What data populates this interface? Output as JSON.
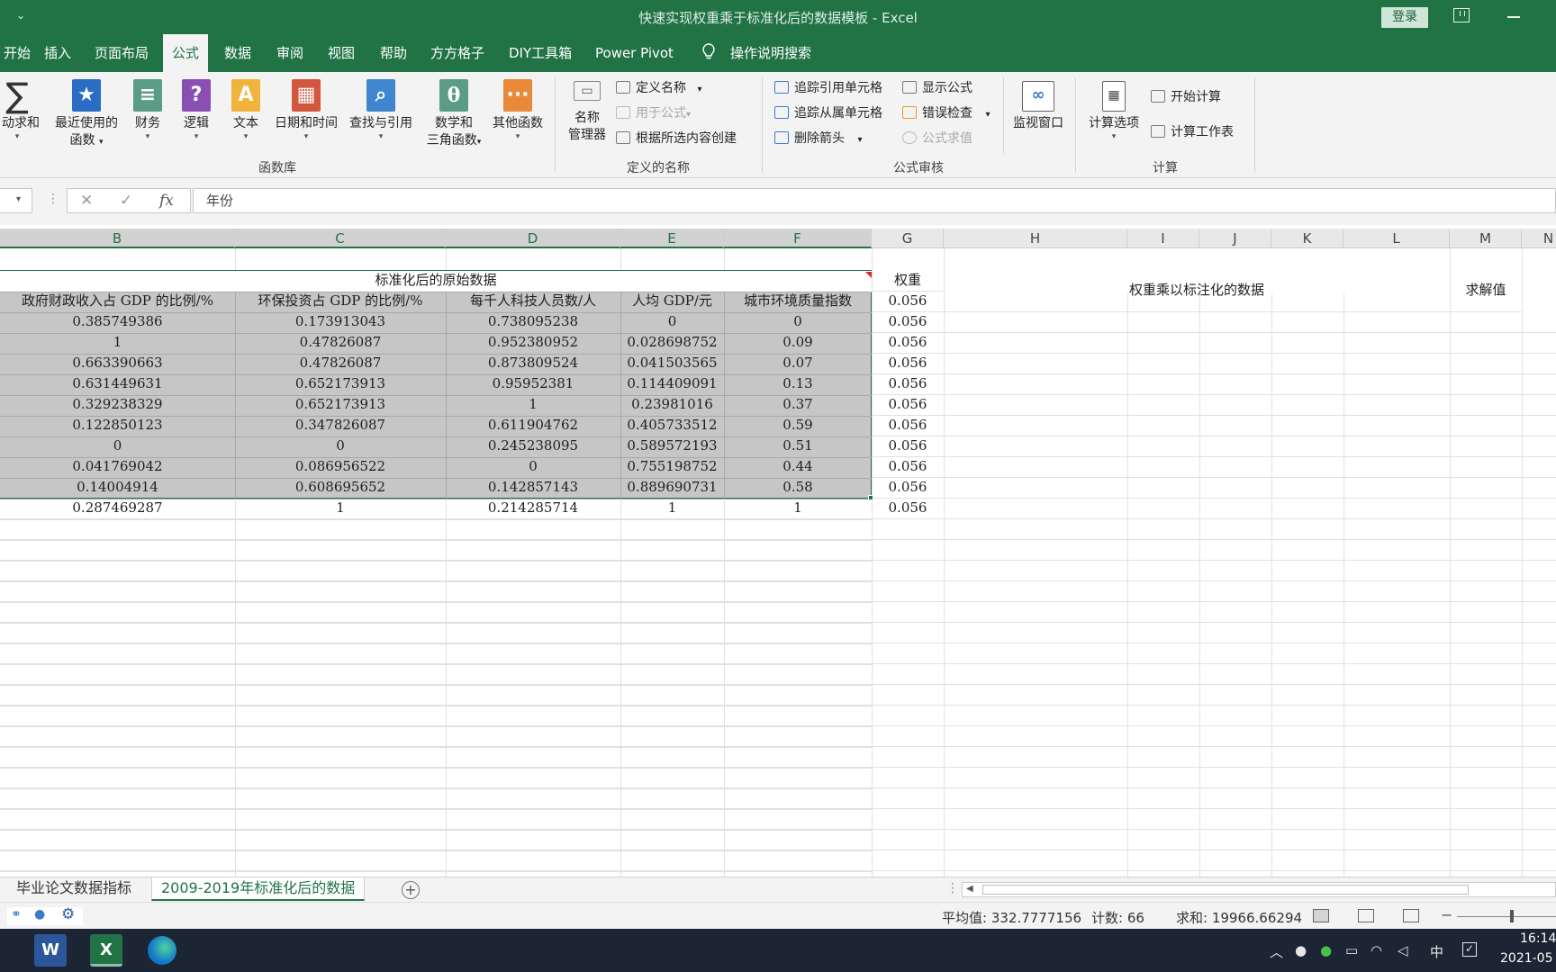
{
  "window": {
    "title": "快速实现权重乘于标准化后的数据模板  -  Excel",
    "login_label": "登录"
  },
  "tabs": [
    "开始",
    "插入",
    "页面布局",
    "公式",
    "数据",
    "审阅",
    "视图",
    "帮助",
    "方方格子",
    "DIY工具箱",
    "Power Pivot"
  ],
  "active_tab": "公式",
  "tell_me": "操作说明搜索",
  "ribbon": {
    "function_library": {
      "label": "函数库",
      "autosum": "自动求和",
      "recent": "最近使用的",
      "recent2": "函数",
      "financial": "财务",
      "logical": "逻辑",
      "text": "文本",
      "datetime": "日期和时间",
      "lookup": "查找与引用",
      "math": "数学和",
      "math2": "三角函数",
      "more": "其他函数"
    },
    "defined_names": {
      "label": "定义的名称",
      "name_manager": "名称",
      "name_manager2": "管理器",
      "define_name": "定义名称",
      "use_in_formula": "用于公式",
      "create_from_selection": "根据所选内容创建"
    },
    "formula_auditing": {
      "label": "公式审核",
      "trace_precedents": "追踪引用单元格",
      "trace_dependents": "追踪从属单元格",
      "remove_arrows": "删除箭头",
      "show_formulas": "显示公式",
      "error_checking": "错误检查",
      "evaluate_formula": "公式求值",
      "watch_window": "监视窗口"
    },
    "calculation": {
      "label": "计算",
      "calc_options": "计算选项",
      "calc_now": "开始计算",
      "calc_sheet": "计算工作表"
    }
  },
  "formula_bar": {
    "cancel": "✕",
    "enter": "✓",
    "fx": "fx",
    "value": "年份"
  },
  "columns": [
    "B",
    "C",
    "D",
    "E",
    "F",
    "G",
    "H",
    "I",
    "J",
    "K",
    "L",
    "M",
    "N"
  ],
  "sheet": {
    "merged_title": "标准化后的原始数据",
    "weight_header": "权重",
    "weighted_header": "权重乘以标注化的数据",
    "solution_header": "求解值",
    "headers": [
      "政府财政收入占 GDP 的比例/%",
      "环保投资占 GDP 的比例/%",
      "每千人科技人员数/人",
      "人均 GDP/元",
      "城市环境质量指数"
    ],
    "weight_first": "0.056",
    "rows": [
      [
        "0.385749386",
        "0.173913043",
        "0.738095238",
        "0",
        "0",
        "0.056"
      ],
      [
        "1",
        "0.47826087",
        "0.952380952",
        "0.028698752",
        "0.09",
        "0.056"
      ],
      [
        "0.663390663",
        "0.47826087",
        "0.873809524",
        "0.041503565",
        "0.07",
        "0.056"
      ],
      [
        "0.631449631",
        "0.652173913",
        "0.95952381",
        "0.114409091",
        "0.13",
        "0.056"
      ],
      [
        "0.329238329",
        "0.652173913",
        "1",
        "0.23981016",
        "0.37",
        "0.056"
      ],
      [
        "0.122850123",
        "0.347826087",
        "0.611904762",
        "0.405733512",
        "0.59",
        "0.056"
      ],
      [
        "0",
        "0",
        "0.245238095",
        "0.589572193",
        "0.51",
        "0.056"
      ],
      [
        "0.041769042",
        "0.086956522",
        "0",
        "0.755198752",
        "0.44",
        "0.056"
      ],
      [
        "0.14004914",
        "0.608695652",
        "0.142857143",
        "0.889690731",
        "0.58",
        "0.056"
      ],
      [
        "0.287469287",
        "1",
        "0.214285714",
        "1",
        "1",
        "0.056"
      ]
    ]
  },
  "sheet_tabs": [
    "毕业论文数据指标",
    "2009-2019年标准化后的数据"
  ],
  "active_sheet": "2009-2019年标准化后的数据",
  "status": {
    "average": "平均值: 332.7777156",
    "count": "计数: 66",
    "sum": "求和: 19966.66294"
  },
  "taskbar": {
    "ime": "中",
    "time": "16:14",
    "date": "2021-05"
  },
  "colors": {
    "excel_green": "#217346",
    "selection_fill": "#c6c6c6",
    "taskbar": "#1b2534"
  }
}
